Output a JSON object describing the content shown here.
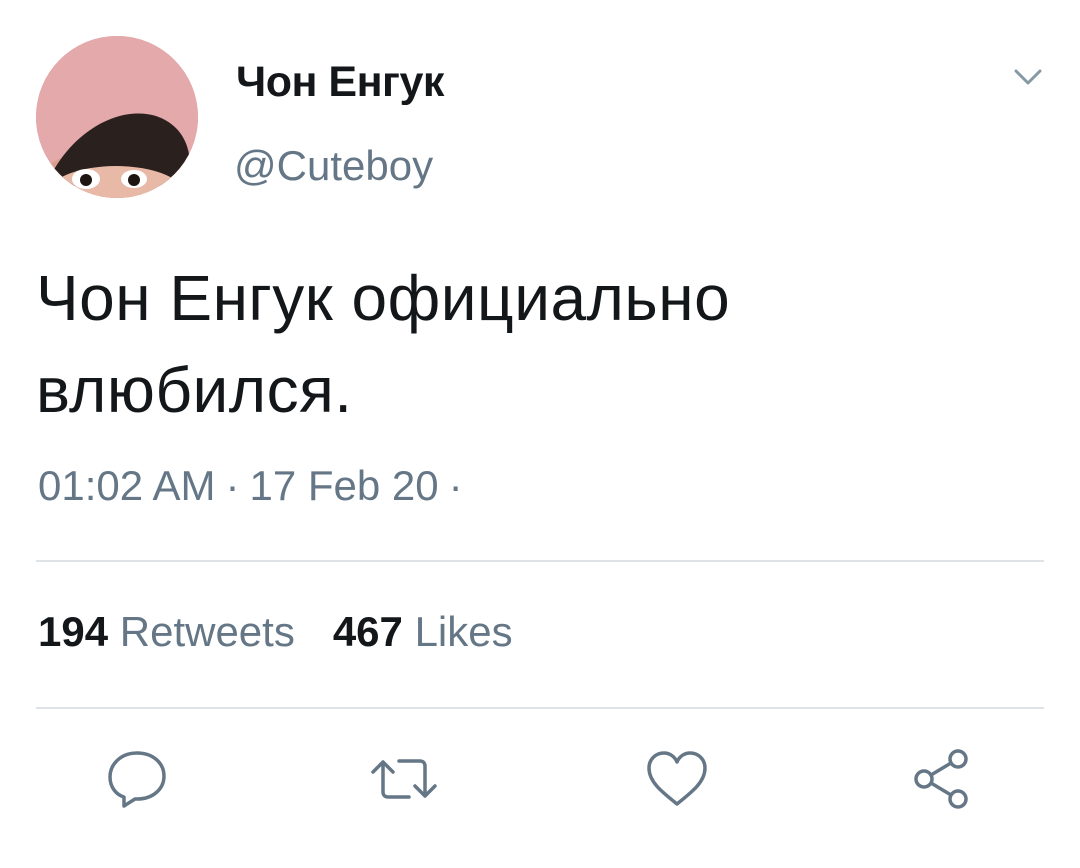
{
  "user": {
    "display_name": "Чон Енгук",
    "handle": "@Cuteboy",
    "avatar_icon": "avatar-photo"
  },
  "tweet": {
    "text_line1": "Чон Енгук официально",
    "text_line2": "влюбился.",
    "time": "01:02 AM",
    "date": "17 Feb 20",
    "separator": "·"
  },
  "stats": {
    "retweets_count": "194",
    "retweets_label": "Retweets",
    "likes_count": "467",
    "likes_label": "Likes"
  },
  "actions": {
    "icons": [
      "reply-icon",
      "retweet-icon",
      "like-icon",
      "share-icon"
    ]
  },
  "colors": {
    "text_primary": "#14171a",
    "text_secondary": "#657786",
    "divider": "#dfe3e8",
    "icon": "#657786"
  }
}
